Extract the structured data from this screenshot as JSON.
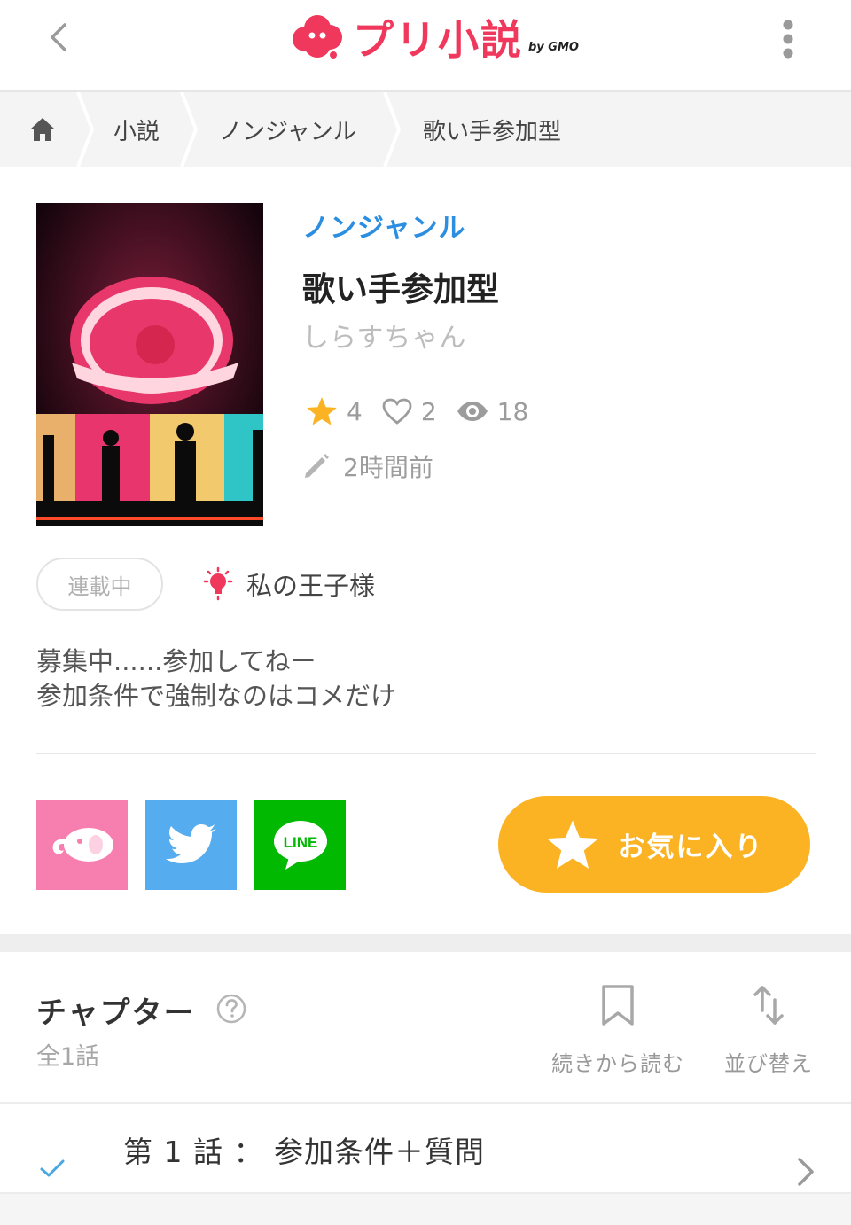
{
  "header": {
    "logo_text": "プリ小説",
    "logo_sub": "by GMO",
    "brand_color": "#f0385c"
  },
  "breadcrumb": {
    "home_icon": "home-icon",
    "items": [
      "小説",
      "ノンジャンル",
      "歌い手参加型"
    ]
  },
  "book": {
    "genre": "ノンジャンル",
    "title": "歌い手参加型",
    "author": "しらすちゃん",
    "stats": {
      "favorites": "4",
      "likes": "2",
      "views": "18"
    },
    "updated": "2時間前",
    "status": "連載中",
    "tag": "私の王子様",
    "description_lines": [
      "募集中......参加してねー",
      "参加条件で強制なのはコメだけ"
    ]
  },
  "share": {
    "buttons": [
      {
        "name": "prichat-share",
        "icon": "elephant-icon",
        "color": "#f77fb0"
      },
      {
        "name": "twitter-share",
        "icon": "twitter-bird-icon",
        "color": "#55acee"
      },
      {
        "name": "line-share",
        "icon": "line-icon",
        "color": "#00b900",
        "label": "LINE"
      }
    ],
    "favorite_label": "お気に入り",
    "favorite_color": "#fbb324"
  },
  "chapters": {
    "heading": "チャプター",
    "count": "全1話",
    "continue_label": "続きから読む",
    "sort_label": "並び替え",
    "items": [
      {
        "title": "第 1 話 ： 参加条件＋質問",
        "read": true
      }
    ]
  },
  "colors": {
    "link_blue": "#2b8ee0",
    "star_yellow": "#fbb324",
    "check_blue": "#4aa8e0"
  }
}
